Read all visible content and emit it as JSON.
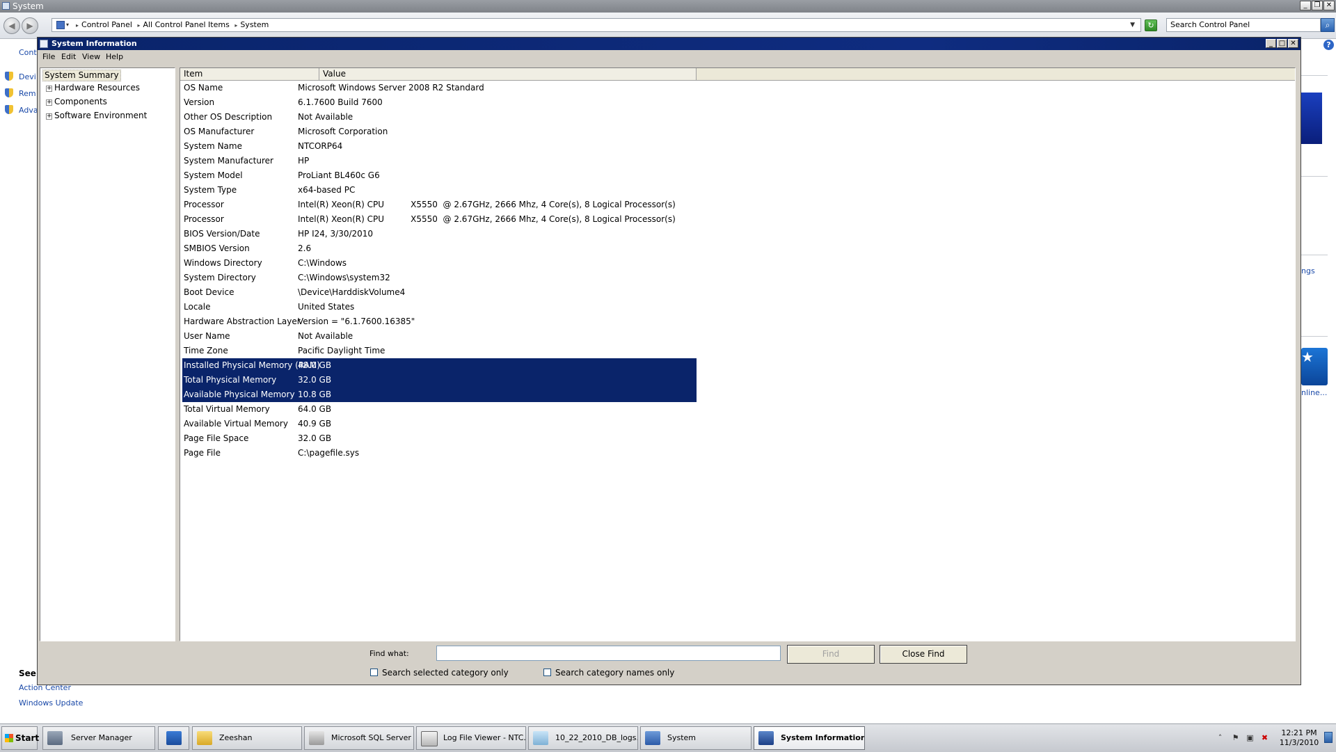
{
  "background_window": {
    "title": "System",
    "breadcrumb": [
      "Control Panel",
      "All Control Panel Items",
      "System"
    ],
    "search_placeholder": "Search Control Panel",
    "left_links": [
      "Cont",
      "Devi",
      "Rem",
      "Adva"
    ],
    "see_also_heading": "See",
    "see_also_links": [
      "Action Center",
      "Windows Update"
    ],
    "right_fragments": [
      "ngs",
      "nline..."
    ]
  },
  "sysinfo": {
    "title": "System Information",
    "menu": [
      "File",
      "Edit",
      "View",
      "Help"
    ],
    "tree": {
      "root": "System Summary",
      "children": [
        "Hardware Resources",
        "Components",
        "Software Environment"
      ]
    },
    "columns": [
      "Item",
      "Value"
    ],
    "rows": [
      {
        "item": "OS Name",
        "value": "Microsoft Windows Server 2008 R2 Standard"
      },
      {
        "item": "Version",
        "value": "6.1.7600 Build 7600"
      },
      {
        "item": "Other OS Description",
        "value": "Not Available"
      },
      {
        "item": "OS Manufacturer",
        "value": "Microsoft Corporation"
      },
      {
        "item": "System Name",
        "value": "NTCORP64"
      },
      {
        "item": "System Manufacturer",
        "value": "HP"
      },
      {
        "item": "System Model",
        "value": "ProLiant BL460c G6"
      },
      {
        "item": "System Type",
        "value": "x64-based PC"
      },
      {
        "item": "Processor",
        "value": "Intel(R) Xeon(R) CPU          X5550  @ 2.67GHz, 2666 Mhz, 4 Core(s), 8 Logical Processor(s)"
      },
      {
        "item": "Processor",
        "value": "Intel(R) Xeon(R) CPU          X5550  @ 2.67GHz, 2666 Mhz, 4 Core(s), 8 Logical Processor(s)"
      },
      {
        "item": "BIOS Version/Date",
        "value": "HP I24, 3/30/2010"
      },
      {
        "item": "SMBIOS Version",
        "value": "2.6"
      },
      {
        "item": "Windows Directory",
        "value": "C:\\Windows"
      },
      {
        "item": "System Directory",
        "value": "C:\\Windows\\system32"
      },
      {
        "item": "Boot Device",
        "value": "\\Device\\HarddiskVolume4"
      },
      {
        "item": "Locale",
        "value": "United States"
      },
      {
        "item": "Hardware Abstraction Layer",
        "value": "Version = \"6.1.7600.16385\""
      },
      {
        "item": "User Name",
        "value": "Not Available"
      },
      {
        "item": "Time Zone",
        "value": "Pacific Daylight Time"
      },
      {
        "item": "Installed Physical Memory (RAM)",
        "value": "48.0 GB"
      },
      {
        "item": "Total Physical Memory",
        "value": "32.0 GB"
      },
      {
        "item": "Available Physical Memory",
        "value": "10.8 GB"
      },
      {
        "item": "Total Virtual Memory",
        "value": "64.0 GB"
      },
      {
        "item": "Available Virtual Memory",
        "value": "40.9 GB"
      },
      {
        "item": "Page File Space",
        "value": "32.0 GB"
      },
      {
        "item": "Page File",
        "value": "C:\\pagefile.sys"
      }
    ],
    "find": {
      "label": "Find what:",
      "value": "",
      "find_button": "Find",
      "close_find_button": "Close Find",
      "opt_selected_category": "Search selected category only",
      "opt_category_names": "Search category names only"
    }
  },
  "taskbar": {
    "start_label": "Start",
    "items": [
      {
        "label": "Server Manager",
        "icon": "server-manager-icon"
      },
      {
        "label": "",
        "icon": "powershell-icon"
      },
      {
        "label": "Zeeshan",
        "icon": "folder-icon"
      },
      {
        "label": "Microsoft SQL Server ...",
        "icon": "sql-server-icon"
      },
      {
        "label": "Log File Viewer - NTC...",
        "icon": "log-viewer-icon"
      },
      {
        "label": "10_22_2010_DB_logs...",
        "icon": "notepad-icon"
      },
      {
        "label": "System",
        "icon": "system-icon"
      },
      {
        "label": "System Information",
        "icon": "system-information-icon",
        "active": true
      }
    ],
    "clock_time": "12:21 PM",
    "clock_date": "11/3/2010"
  },
  "colors": {
    "selection": "#0a246a",
    "titlebar_active": "#0a246a",
    "link": "#1a49a8"
  }
}
